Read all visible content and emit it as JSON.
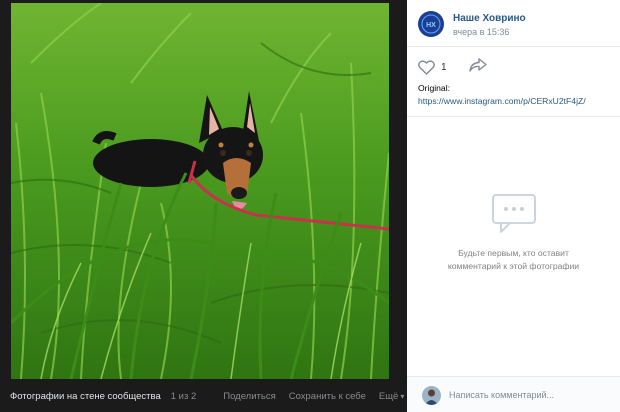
{
  "viewer": {
    "album_title": "Фотографии на стене сообщества",
    "counter": "1 из 2",
    "share_label": "Поделиться",
    "save_label": "Сохранить к себе",
    "more_label": "Ещё"
  },
  "post": {
    "group_name": "Наше Ховрино",
    "avatar_text": "НХ",
    "time": "вчера в 15:36",
    "likes": "1",
    "description_prefix": "Original:",
    "description_link": "https://www.instagram.com/p/CERxU2tF4jZ/"
  },
  "comments": {
    "empty_line1": "Будьте первым, кто оставит",
    "empty_line2": "комментарий к этой фотографии",
    "placeholder": "Написать комментарий..."
  },
  "colors": {
    "link": "#2a5885",
    "viewer_bg": "#1b1b1b",
    "panel_bg": "#ffffff"
  }
}
